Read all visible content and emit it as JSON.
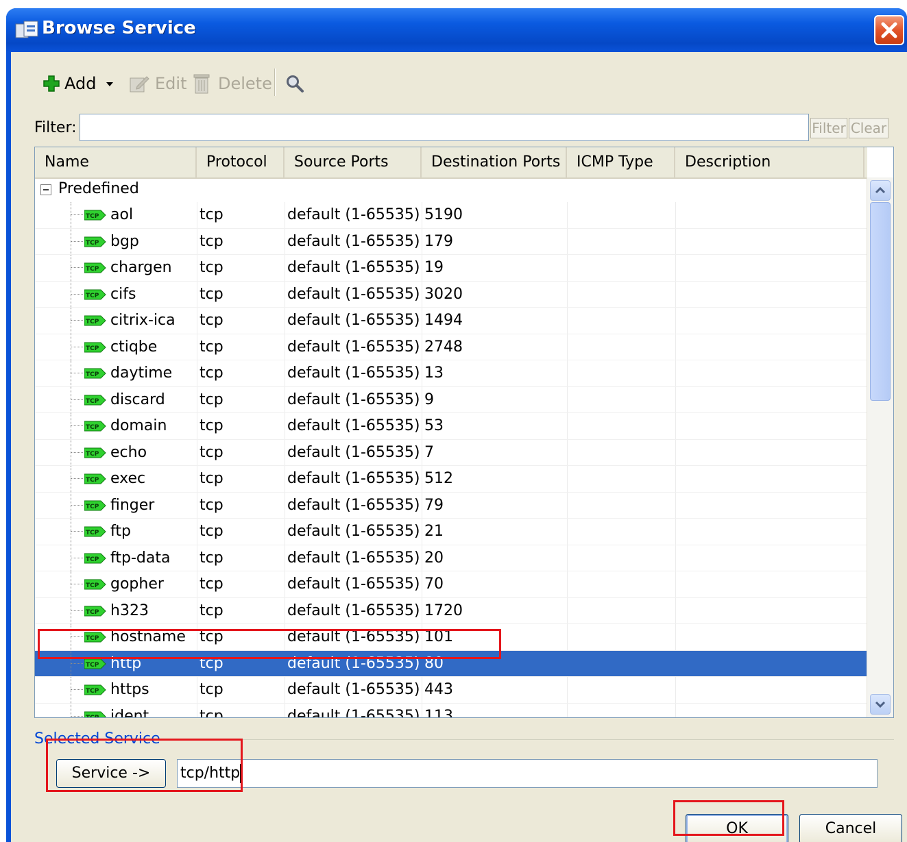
{
  "window": {
    "title": "Browse Service"
  },
  "toolbar": {
    "add_label": "Add",
    "edit_label": "Edit",
    "delete_label": "Delete"
  },
  "filter": {
    "label": "Filter:",
    "value": "",
    "filter_button": "Filter",
    "clear_button": "Clear"
  },
  "table": {
    "columns": [
      "Name",
      "Protocol",
      "Source Ports",
      "Destination Ports",
      "ICMP Type",
      "Description"
    ],
    "group_label": "Predefined",
    "badge": "TCP",
    "rows": [
      {
        "name": "aol",
        "protocol": "tcp",
        "source": "default (1-65535)",
        "dest": "5190",
        "icmp": "",
        "desc": ""
      },
      {
        "name": "bgp",
        "protocol": "tcp",
        "source": "default (1-65535)",
        "dest": "179",
        "icmp": "",
        "desc": ""
      },
      {
        "name": "chargen",
        "protocol": "tcp",
        "source": "default (1-65535)",
        "dest": "19",
        "icmp": "",
        "desc": ""
      },
      {
        "name": "cifs",
        "protocol": "tcp",
        "source": "default (1-65535)",
        "dest": "3020",
        "icmp": "",
        "desc": ""
      },
      {
        "name": "citrix-ica",
        "protocol": "tcp",
        "source": "default (1-65535)",
        "dest": "1494",
        "icmp": "",
        "desc": ""
      },
      {
        "name": "ctiqbe",
        "protocol": "tcp",
        "source": "default (1-65535)",
        "dest": "2748",
        "icmp": "",
        "desc": ""
      },
      {
        "name": "daytime",
        "protocol": "tcp",
        "source": "default (1-65535)",
        "dest": "13",
        "icmp": "",
        "desc": ""
      },
      {
        "name": "discard",
        "protocol": "tcp",
        "source": "default (1-65535)",
        "dest": "9",
        "icmp": "",
        "desc": ""
      },
      {
        "name": "domain",
        "protocol": "tcp",
        "source": "default (1-65535)",
        "dest": "53",
        "icmp": "",
        "desc": ""
      },
      {
        "name": "echo",
        "protocol": "tcp",
        "source": "default (1-65535)",
        "dest": "7",
        "icmp": "",
        "desc": ""
      },
      {
        "name": "exec",
        "protocol": "tcp",
        "source": "default (1-65535)",
        "dest": "512",
        "icmp": "",
        "desc": ""
      },
      {
        "name": "finger",
        "protocol": "tcp",
        "source": "default (1-65535)",
        "dest": "79",
        "icmp": "",
        "desc": ""
      },
      {
        "name": "ftp",
        "protocol": "tcp",
        "source": "default (1-65535)",
        "dest": "21",
        "icmp": "",
        "desc": ""
      },
      {
        "name": "ftp-data",
        "protocol": "tcp",
        "source": "default (1-65535)",
        "dest": "20",
        "icmp": "",
        "desc": ""
      },
      {
        "name": "gopher",
        "protocol": "tcp",
        "source": "default (1-65535)",
        "dest": "70",
        "icmp": "",
        "desc": ""
      },
      {
        "name": "h323",
        "protocol": "tcp",
        "source": "default (1-65535)",
        "dest": "1720",
        "icmp": "",
        "desc": ""
      },
      {
        "name": "hostname",
        "protocol": "tcp",
        "source": "default (1-65535)",
        "dest": "101",
        "icmp": "",
        "desc": ""
      },
      {
        "name": "http",
        "protocol": "tcp",
        "source": "default (1-65535)",
        "dest": "80",
        "icmp": "",
        "desc": "",
        "selected": true
      },
      {
        "name": "https",
        "protocol": "tcp",
        "source": "default (1-65535)",
        "dest": "443",
        "icmp": "",
        "desc": ""
      },
      {
        "name": "ident",
        "protocol": "tcp",
        "source": "default (1-65535)",
        "dest": "113",
        "icmp": "",
        "desc": ""
      }
    ]
  },
  "selected_service": {
    "label": "Selected Service",
    "button": "Service ->",
    "value": "tcp/http"
  },
  "buttons": {
    "ok": "OK",
    "cancel": "Cancel"
  },
  "colors": {
    "title_bar": "#0a52d8",
    "selection": "#316ac5",
    "highlight_box": "#e4161c",
    "dialog_bg": "#ece9d8"
  }
}
